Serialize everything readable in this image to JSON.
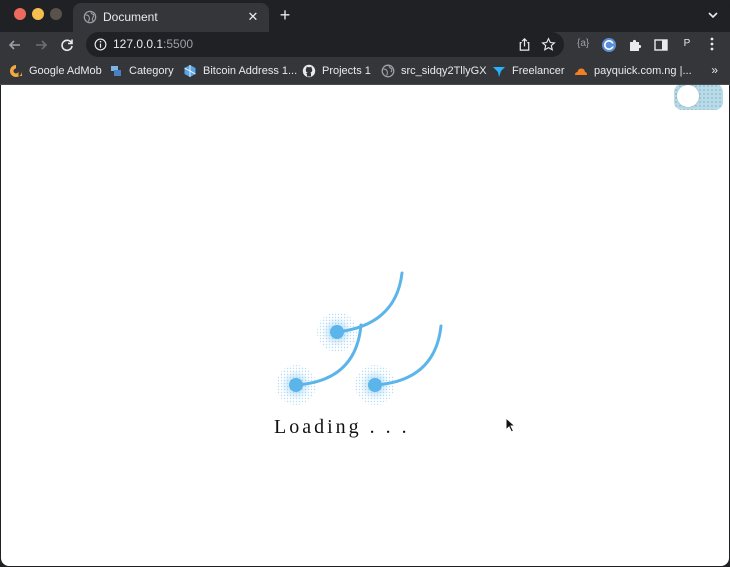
{
  "tab": {
    "title": "Document"
  },
  "address": {
    "host": "127.0.0.1",
    "port": ":5500"
  },
  "extensions": {
    "badge_text": "{a}"
  },
  "profile": {
    "initial": "P"
  },
  "bookmarks": [
    {
      "label": "Google AdMob",
      "icon": "admob-icon",
      "color": "#f4a742"
    },
    {
      "label": "Category",
      "icon": "category-icon",
      "color": "#7fb2e5"
    },
    {
      "label": "Bitcoin Address 1...",
      "icon": "bitcoin-address-icon",
      "color": "#5ba4e5"
    },
    {
      "label": "Projects 1",
      "icon": "github-icon",
      "color": "#e8eaed"
    },
    {
      "label": "src_sidqy2TllyGX",
      "icon": "globe-icon",
      "color": "#9aa0a6"
    },
    {
      "label": "Freelancer",
      "icon": "freelancer-icon",
      "color": "#29b2fe"
    },
    {
      "label": "payquick.com.ng |...",
      "icon": "cloud-icon",
      "color": "#f38020"
    }
  ],
  "bookmarks_more": "»",
  "page": {
    "loading_text": "Loading . . .",
    "accent_color": "#5bb4ea",
    "toggle_color": "#b9dbe8"
  }
}
